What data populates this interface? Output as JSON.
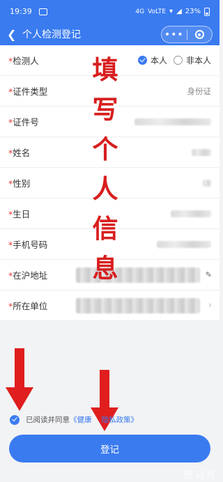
{
  "status_bar": {
    "time": "19:39",
    "network": "4G",
    "volte": "VoLTE",
    "battery": "23%"
  },
  "nav": {
    "back_icon": "chevron-left-icon",
    "title": "个人检测登记",
    "more_icon": "more-dots-icon",
    "close_icon": "target-close-icon"
  },
  "form": {
    "rows": [
      {
        "label": "检测人",
        "type": "radio",
        "options": [
          "本人",
          "非本人"
        ],
        "selected": "本人"
      },
      {
        "label": "证件类型",
        "type": "text",
        "value": "身份证"
      },
      {
        "label": "证件号",
        "type": "blurred"
      },
      {
        "label": "姓名",
        "type": "blurred"
      },
      {
        "label": "性别",
        "type": "blurred"
      },
      {
        "label": "生日",
        "type": "blurred"
      },
      {
        "label": "手机号码",
        "type": "blurred"
      },
      {
        "label": "在沪地址",
        "type": "blurred-edit",
        "icon": "edit-pencil-icon"
      },
      {
        "label": "所在单位",
        "type": "blurred-arrow",
        "icon": "chevron-right-icon"
      }
    ],
    "required_mark": "*"
  },
  "overlay_text": [
    "填",
    "写",
    "个",
    "人",
    "信",
    "息"
  ],
  "agreement": {
    "checked": true,
    "prefix": "已阅读并同意",
    "link": "《健康",
    "link_suffix": "隐私政策》"
  },
  "submit_label": "登记",
  "watermark": "斑马号",
  "colors": {
    "primary": "#3a7bf0",
    "annotation_red": "#e01e1e"
  }
}
